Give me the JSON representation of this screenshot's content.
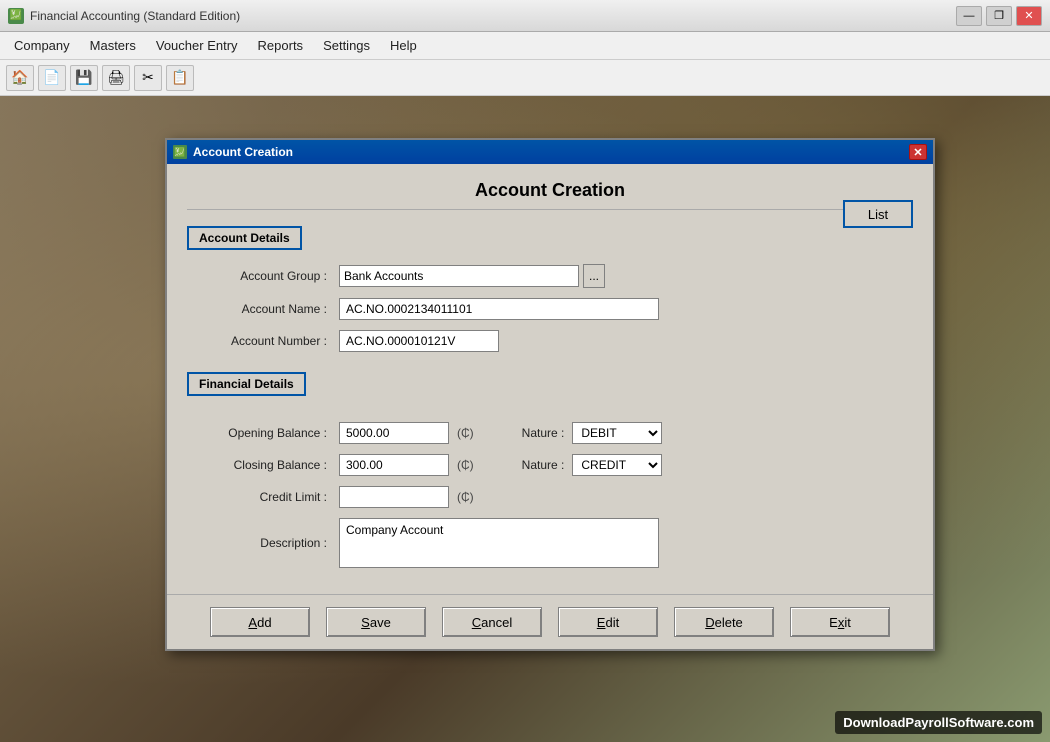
{
  "app": {
    "title": "Financial Accounting (Standard Edition)"
  },
  "titlebar": {
    "title": "Financial Accounting (Standard Edition)",
    "minimize": "—",
    "restore": "❐",
    "close": "✕"
  },
  "menubar": {
    "items": [
      {
        "id": "company",
        "label": "Company"
      },
      {
        "id": "masters",
        "label": "Masters"
      },
      {
        "id": "voucher-entry",
        "label": "Voucher Entry"
      },
      {
        "id": "reports",
        "label": "Reports"
      },
      {
        "id": "settings",
        "label": "Settings"
      },
      {
        "id": "help",
        "label": "Help"
      }
    ]
  },
  "dialog": {
    "titlebar_label": "Account Creation",
    "main_title": "Account Creation",
    "list_button": "List",
    "account_details_section": "Account Details",
    "financial_details_section": "Financial Details",
    "fields": {
      "account_group_label": "Account Group :",
      "account_group_value": "Bank Accounts",
      "account_name_label": "Account Name :",
      "account_name_value": "AC.NO.0002134011101",
      "account_number_label": "Account Number :",
      "account_number_value": "AC.NO.000010121V",
      "opening_balance_label": "Opening Balance :",
      "opening_balance_value": "5000.00",
      "opening_nature_label": "Nature :",
      "opening_nature_value": "DEBIT",
      "closing_balance_label": "Closing Balance :",
      "closing_balance_value": "300.00",
      "closing_nature_label": "Nature :",
      "closing_nature_value": "CREDIT",
      "credit_limit_label": "Credit Limit :",
      "credit_limit_value": "",
      "description_label": "Description :",
      "description_value": "Company Account",
      "currency_symbol": "(₵)"
    },
    "nature_options": [
      "DEBIT",
      "CREDIT"
    ],
    "buttons": {
      "add": "Add",
      "save": "Save",
      "cancel": "Cancel",
      "edit": "Edit",
      "delete": "Delete",
      "exit": "Exit"
    }
  },
  "watermark": "DownloadPayrollSoftware.com",
  "toolbar": {
    "buttons": [
      "🏠",
      "📄",
      "💾",
      "🖨",
      "✂",
      "📋"
    ]
  }
}
